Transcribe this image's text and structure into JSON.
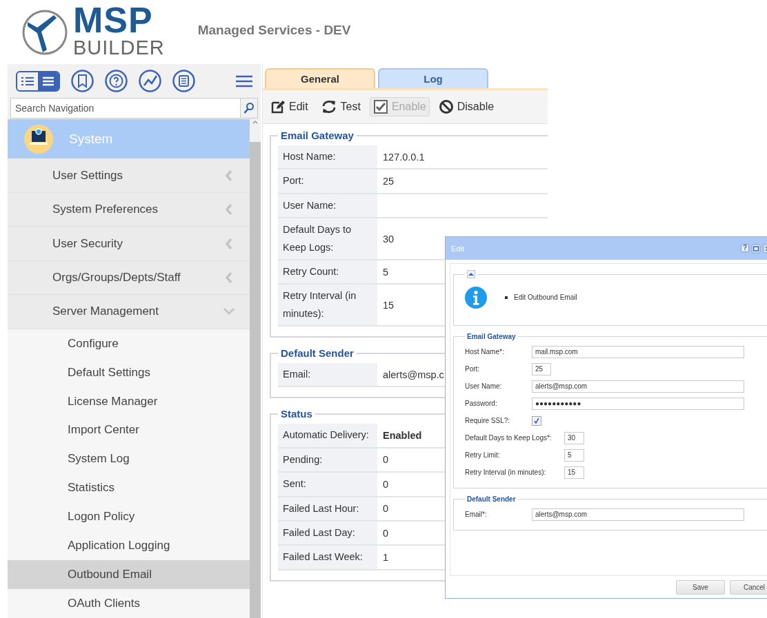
{
  "header": {
    "logo": {
      "line_1": "MSP",
      "line_2": "BUILDER"
    },
    "title": "Managed Services - DEV"
  },
  "sidebar": {
    "view_modes": [
      {
        "selected": false
      },
      {
        "selected": true
      }
    ],
    "search": {
      "placeholder": "Search Navigation"
    },
    "section": {
      "label": "System"
    },
    "items": [
      {
        "label": "User Settings",
        "expanded": false
      },
      {
        "label": "System Preferences",
        "expanded": false
      },
      {
        "label": "User Security",
        "expanded": false
      },
      {
        "label": "Orgs/Groups/Depts/Staff",
        "expanded": false
      },
      {
        "label": "Server Management",
        "expanded": true,
        "children": [
          {
            "label": "Configure",
            "selected": false
          },
          {
            "label": "Default Settings",
            "selected": false
          },
          {
            "label": "License Manager",
            "selected": false
          },
          {
            "label": "Import Center",
            "selected": false
          },
          {
            "label": "System Log",
            "selected": false
          },
          {
            "label": "Statistics",
            "selected": false
          },
          {
            "label": "Logon Policy",
            "selected": false
          },
          {
            "label": "Application Logging",
            "selected": false
          },
          {
            "label": "Outbound Email",
            "selected": true
          },
          {
            "label": "OAuth Clients",
            "selected": false
          }
        ]
      }
    ]
  },
  "tabs": [
    {
      "label": "General",
      "selected": true
    },
    {
      "label": "Log",
      "selected": false
    }
  ],
  "toolbar": [
    {
      "label": "Edit",
      "kind": "edit",
      "disabled": false
    },
    {
      "label": "Test",
      "kind": "test",
      "disabled": false
    },
    {
      "label": "Enable",
      "kind": "enable",
      "disabled": true
    },
    {
      "label": "Disable",
      "kind": "disable",
      "disabled": false
    }
  ],
  "sections": [
    {
      "title": "Email Gateway",
      "rows": [
        {
          "label": "Host Name:",
          "value": "127.0.0.1"
        },
        {
          "label": "Port:",
          "value": "25"
        },
        {
          "label": "User Name:"
        },
        {
          "label": "Default Days to Keep Logs:",
          "value": "30"
        },
        {
          "label": "Retry Count:",
          "value": "5"
        },
        {
          "label": "Retry Interval (in minutes):",
          "value": "15"
        }
      ]
    },
    {
      "title": "Default Sender",
      "rows": [
        {
          "label": "Email:",
          "value": "alerts@msp.c"
        }
      ]
    },
    {
      "title": "Status",
      "rows": [
        {
          "label": "Automatic Delivery:",
          "value": "Enabled",
          "strong": true
        },
        {
          "label": "Pending:",
          "value": "0"
        },
        {
          "label": "Sent:",
          "value": "0"
        },
        {
          "label": "Failed Last Hour:",
          "value": "0"
        },
        {
          "label": "Failed Last Day:",
          "value": "0"
        },
        {
          "label": "Failed Last Week:",
          "value": "1"
        }
      ]
    }
  ],
  "dialog": {
    "title": "Edit",
    "help": "?",
    "info": {
      "items": [
        "Edit Outbound Email"
      ]
    },
    "sections": [
      {
        "title": "Email Gateway",
        "fields": [
          {
            "label": "Host Name*:",
            "kind": "text",
            "value": "mail.msp.com"
          },
          {
            "label": "Port:",
            "kind": "short",
            "value": "25"
          },
          {
            "label": "User Name:",
            "kind": "text",
            "value": "alerts@msp.com"
          },
          {
            "label": "Password:",
            "kind": "text",
            "value": "●●●●●●●●●●●"
          },
          {
            "label": "Require SSL?:",
            "kind": "checkbox",
            "checked": true
          },
          {
            "label": "Default Days to Keep Logs*:",
            "kind": "number",
            "value": "30"
          },
          {
            "label": "Retry Limit:",
            "kind": "number",
            "value": "5"
          },
          {
            "label": "Retry Interval (in minutes):",
            "kind": "number",
            "value": "15"
          }
        ]
      },
      {
        "title": "Default Sender",
        "fields": [
          {
            "label": "Email*:",
            "kind": "text",
            "value": "alerts@msp.com"
          }
        ]
      }
    ],
    "buttons": [
      "Save",
      "Cancel"
    ]
  }
}
